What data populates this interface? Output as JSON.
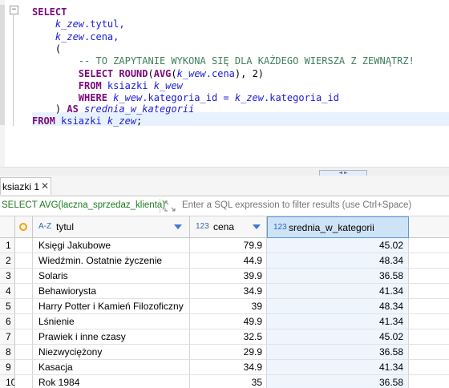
{
  "editor": {
    "fold_symbol": "−",
    "lines": [
      {
        "indent": "",
        "tokens": [
          {
            "t": "SELECT",
            "c": "kw"
          }
        ]
      },
      {
        "indent": "    ",
        "tokens": [
          {
            "t": "k_zew",
            "c": "al"
          },
          {
            "t": ".tytul,",
            "c": "id"
          }
        ]
      },
      {
        "indent": "    ",
        "tokens": [
          {
            "t": "k_zew",
            "c": "al"
          },
          {
            "t": ".cena,",
            "c": "id"
          }
        ]
      },
      {
        "indent": "    ",
        "tokens": [
          {
            "t": "(",
            "c": "num"
          }
        ]
      },
      {
        "indent": "        ",
        "tokens": [
          {
            "t": "-- TO ZAPYTANIE WYKONA SIĘ DLA KAŻDEGO WIERSZA Z ZEWNĄTRZ!",
            "c": "cm"
          }
        ]
      },
      {
        "indent": "        ",
        "tokens": [
          {
            "t": "SELECT ",
            "c": "kw"
          },
          {
            "t": "ROUND",
            "c": "fn"
          },
          {
            "t": "(",
            "c": "num"
          },
          {
            "t": "AVG",
            "c": "fn"
          },
          {
            "t": "(",
            "c": "num"
          },
          {
            "t": "k_wew",
            "c": "al"
          },
          {
            "t": ".cena",
            "c": "id"
          },
          {
            "t": "), 2)",
            "c": "num"
          }
        ]
      },
      {
        "indent": "        ",
        "tokens": [
          {
            "t": "FROM ",
            "c": "kw"
          },
          {
            "t": "ksiazki ",
            "c": "id"
          },
          {
            "t": "k_wew",
            "c": "al"
          }
        ]
      },
      {
        "indent": "        ",
        "tokens": [
          {
            "t": "WHERE ",
            "c": "kw"
          },
          {
            "t": "k_wew",
            "c": "al"
          },
          {
            "t": ".kategoria_id = ",
            "c": "id"
          },
          {
            "t": "k_zew",
            "c": "al"
          },
          {
            "t": ".kategoria_id",
            "c": "id"
          }
        ]
      },
      {
        "indent": "    ",
        "tokens": [
          {
            "t": ") ",
            "c": "num"
          },
          {
            "t": "AS ",
            "c": "kw"
          },
          {
            "t": "srednia_w_kategorii",
            "c": "al"
          }
        ]
      },
      {
        "indent": "",
        "tokens": [
          {
            "t": "FROM ",
            "c": "kw"
          },
          {
            "t": "ksiazki ",
            "c": "id"
          },
          {
            "t": "k_zew",
            "c": "al"
          },
          {
            "t": ";",
            "c": "num"
          }
        ]
      }
    ]
  },
  "splitter": {
    "grip_label": "◄ ►"
  },
  "results_tab": {
    "label": "ksiazki 1",
    "close_symbol": "✕"
  },
  "filter": {
    "query_text": "SELECT AVG(laczna_sprzedaz_klienta)",
    "placeholder": "Enter a SQL expression to filter results (use Ctrl+Space)",
    "icon": "filter-icon"
  },
  "grid": {
    "columns": [
      {
        "type_label": "A-Z",
        "name": "tytul"
      },
      {
        "type_label": "123",
        "name": "cena"
      },
      {
        "type_label": "123",
        "name": "srednia_w_kategorii"
      }
    ],
    "rows": [
      {
        "n": "1",
        "tytul": "Księgi Jakubowe",
        "cena": "79.9",
        "srednia": "45.02"
      },
      {
        "n": "2",
        "tytul": "Wiedźmin. Ostatnie życzenie",
        "cena": "44.9",
        "srednia": "48.34"
      },
      {
        "n": "3",
        "tytul": "Solaris",
        "cena": "39.9",
        "srednia": "36.58"
      },
      {
        "n": "4",
        "tytul": "Behawiorysta",
        "cena": "34.9",
        "srednia": "41.34"
      },
      {
        "n": "5",
        "tytul": "Harry Potter i Kamień Filozoficzny",
        "cena": "39",
        "srednia": "48.34"
      },
      {
        "n": "6",
        "tytul": "Lśnienie",
        "cena": "49.9",
        "srednia": "41.34"
      },
      {
        "n": "7",
        "tytul": "Prawiek i inne czasy",
        "cena": "32.5",
        "srednia": "45.02"
      },
      {
        "n": "8",
        "tytul": "Niezwyciężony",
        "cena": "29.9",
        "srednia": "36.58"
      },
      {
        "n": "9",
        "tytul": "Kasacja",
        "cena": "34.9",
        "srednia": "41.34"
      },
      {
        "n": "10",
        "tytul": "Rok 1984",
        "cena": "35",
        "srednia": "36.58"
      }
    ]
  }
}
